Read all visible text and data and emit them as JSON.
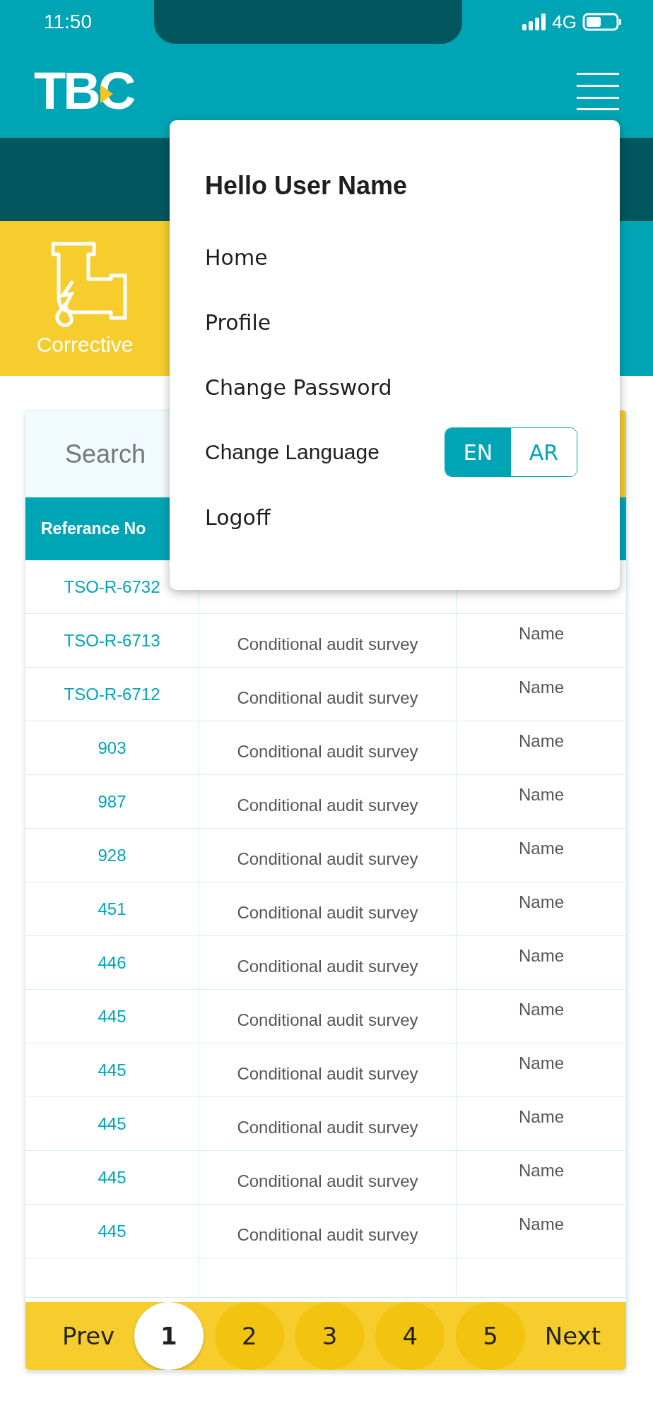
{
  "status_bar": {
    "time": "11:50",
    "network": "4G"
  },
  "header": {
    "logo": "TBC"
  },
  "categories": [
    {
      "label": "Corrective",
      "selected": true
    }
  ],
  "search": {
    "placeholder": "Search"
  },
  "table": {
    "columns": [
      "Referance No"
    ],
    "rows": [
      {
        "ref": "TSO-R-6732"
      },
      {
        "ref": "TSO-R-6713",
        "title": "Conditional audit survey",
        "name": "Name"
      },
      {
        "ref": "TSO-R-6712",
        "title": "Conditional audit survey",
        "name": "Name"
      },
      {
        "ref": "903",
        "title": "Conditional audit survey",
        "name": "Name"
      },
      {
        "ref": "987",
        "title": "Conditional audit survey",
        "name": "Name"
      },
      {
        "ref": "928",
        "title": "Conditional audit survey",
        "name": "Name"
      },
      {
        "ref": "451",
        "title": "Conditional audit survey",
        "name": "Name"
      },
      {
        "ref": "446",
        "title": "Conditional audit survey",
        "name": "Name"
      },
      {
        "ref": "445",
        "title": "Conditional audit survey",
        "name": "Name"
      },
      {
        "ref": "445",
        "title": "Conditional audit survey",
        "name": "Name"
      },
      {
        "ref": "445",
        "title": "Conditional audit survey",
        "name": "Name"
      },
      {
        "ref": "445",
        "title": "Conditional audit survey",
        "name": "Name"
      },
      {
        "ref": "445",
        "title": "Conditional audit survey",
        "name": "Name"
      }
    ]
  },
  "pagination": {
    "prev": "Prev",
    "next": "Next",
    "pages": [
      {
        "label": "1",
        "selected": true
      },
      {
        "label": "2",
        "selected": false
      },
      {
        "label": "3",
        "selected": false
      },
      {
        "label": "4",
        "selected": false
      },
      {
        "label": "5",
        "selected": false
      }
    ]
  },
  "menu": {
    "greeting": "Hello User Name",
    "items": [
      {
        "kind": "link",
        "label": "Home"
      },
      {
        "kind": "link",
        "label": "Profile"
      },
      {
        "kind": "link",
        "label": "Change Password"
      },
      {
        "kind": "language",
        "label": "Change Language",
        "options": [
          {
            "label": "EN",
            "selected": true
          },
          {
            "label": "AR",
            "selected": false
          }
        ]
      },
      {
        "kind": "link",
        "label": "Logoff"
      }
    ]
  }
}
